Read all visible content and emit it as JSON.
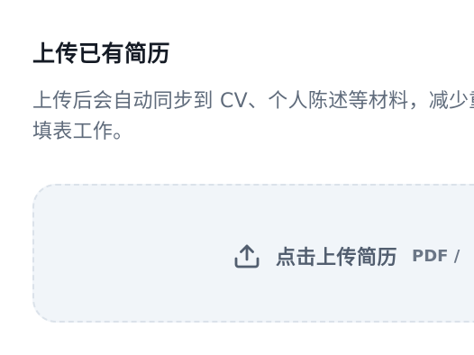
{
  "section": {
    "title": "上传已有简历",
    "description": "上传后会自动同步到 CV、个人陈述等材料，减少重复填表工作。"
  },
  "upload": {
    "icon": "upload-icon",
    "label": "点击上传简历",
    "formats": "PDF / "
  },
  "colors": {
    "title": "#141a24",
    "description": "#5f6b7b",
    "dropzone_bg": "#f1f5f9",
    "dropzone_border": "#dbe2ea",
    "upload_text": "#525e6f"
  }
}
